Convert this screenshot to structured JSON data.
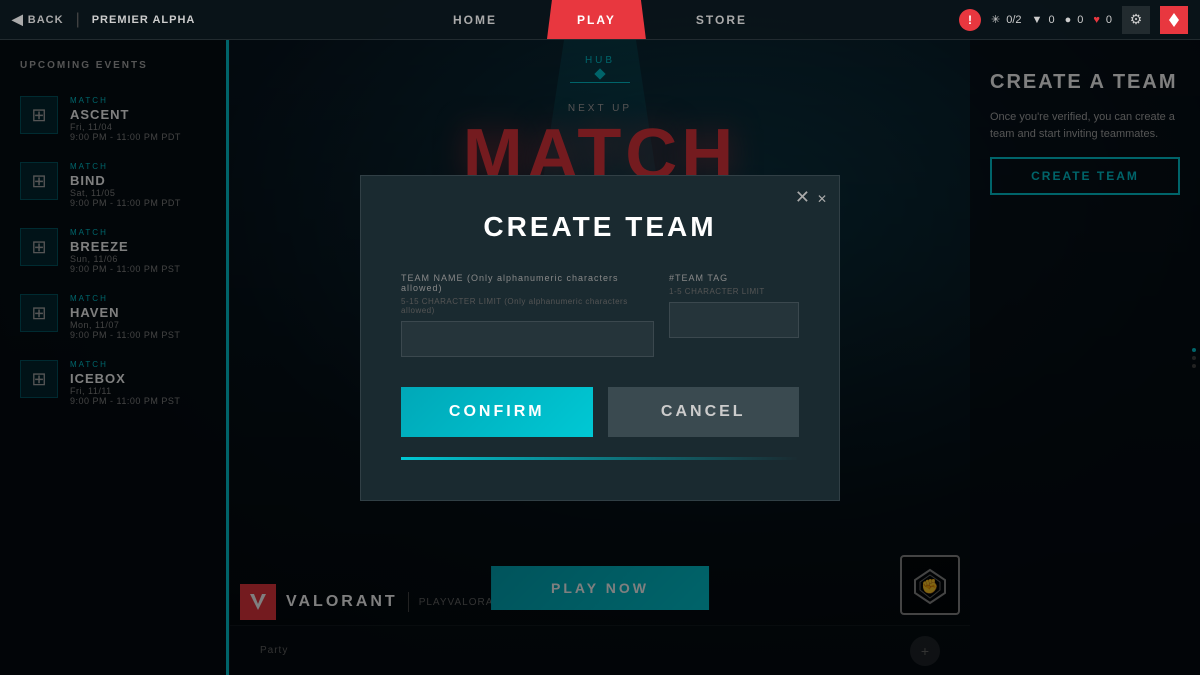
{
  "topbar": {
    "back_label": "BACK",
    "breadcrumb": "PREMIER ALPHA",
    "nav_home": "HOME",
    "nav_play": "PLAY",
    "nav_store": "STORE",
    "currency_vp": "0",
    "currency_rp": "0",
    "currency_kp": "0",
    "stars_label": "0/2"
  },
  "sidebar": {
    "section_title": "UPCOMING EVENTS",
    "events": [
      {
        "name": "ASCENT",
        "type": "MATCH",
        "date": "Fri, 11/04",
        "time": "9:00 PM - 11:00 PM PDT"
      },
      {
        "name": "BIND",
        "type": "MATCH",
        "date": "Sat, 11/05",
        "time": "9:00 PM - 11:00 PM PDT"
      },
      {
        "name": "BREEZE",
        "type": "MATCH",
        "date": "Sun, 11/06",
        "time": "9:00 PM - 11:00 PM PST"
      },
      {
        "name": "HAVEN",
        "type": "MATCH",
        "date": "Mon, 11/07",
        "time": "9:00 PM - 11:00 PM PST"
      },
      {
        "name": "ICEBOX",
        "type": "MATCH",
        "date": "Fri, 11/11",
        "time": "9:00 PM - 11:00 PM PST"
      }
    ]
  },
  "right_panel": {
    "title": "CREATE A TEAM",
    "description": "Once you're verified, you can create a team and start inviting teammates.",
    "button_label": "CREATE TEAM"
  },
  "main": {
    "hub_label": "HUB",
    "next_up_label": "NEXT UP",
    "match_title": "MATCH",
    "play_now_label": "PLAY NOW"
  },
  "modal": {
    "title": "CREATE TEAM",
    "team_name_label": "TEAM NAME (Only alphanumeric characters allowed)",
    "team_name_sublabel": "5-15 CHARACTER LIMIT (Only alphanumeric characters allowed)",
    "team_tag_label": "#TEAM TAG",
    "team_tag_sublabel": "1-5 CHARACTER LIMIT",
    "confirm_label": "CONFIRM",
    "cancel_label": "CANCEL",
    "close_icon": "✕"
  },
  "footer": {
    "party_label": "Party",
    "website": "PLAYVALORANT.COM",
    "brand": "VALORANT"
  }
}
